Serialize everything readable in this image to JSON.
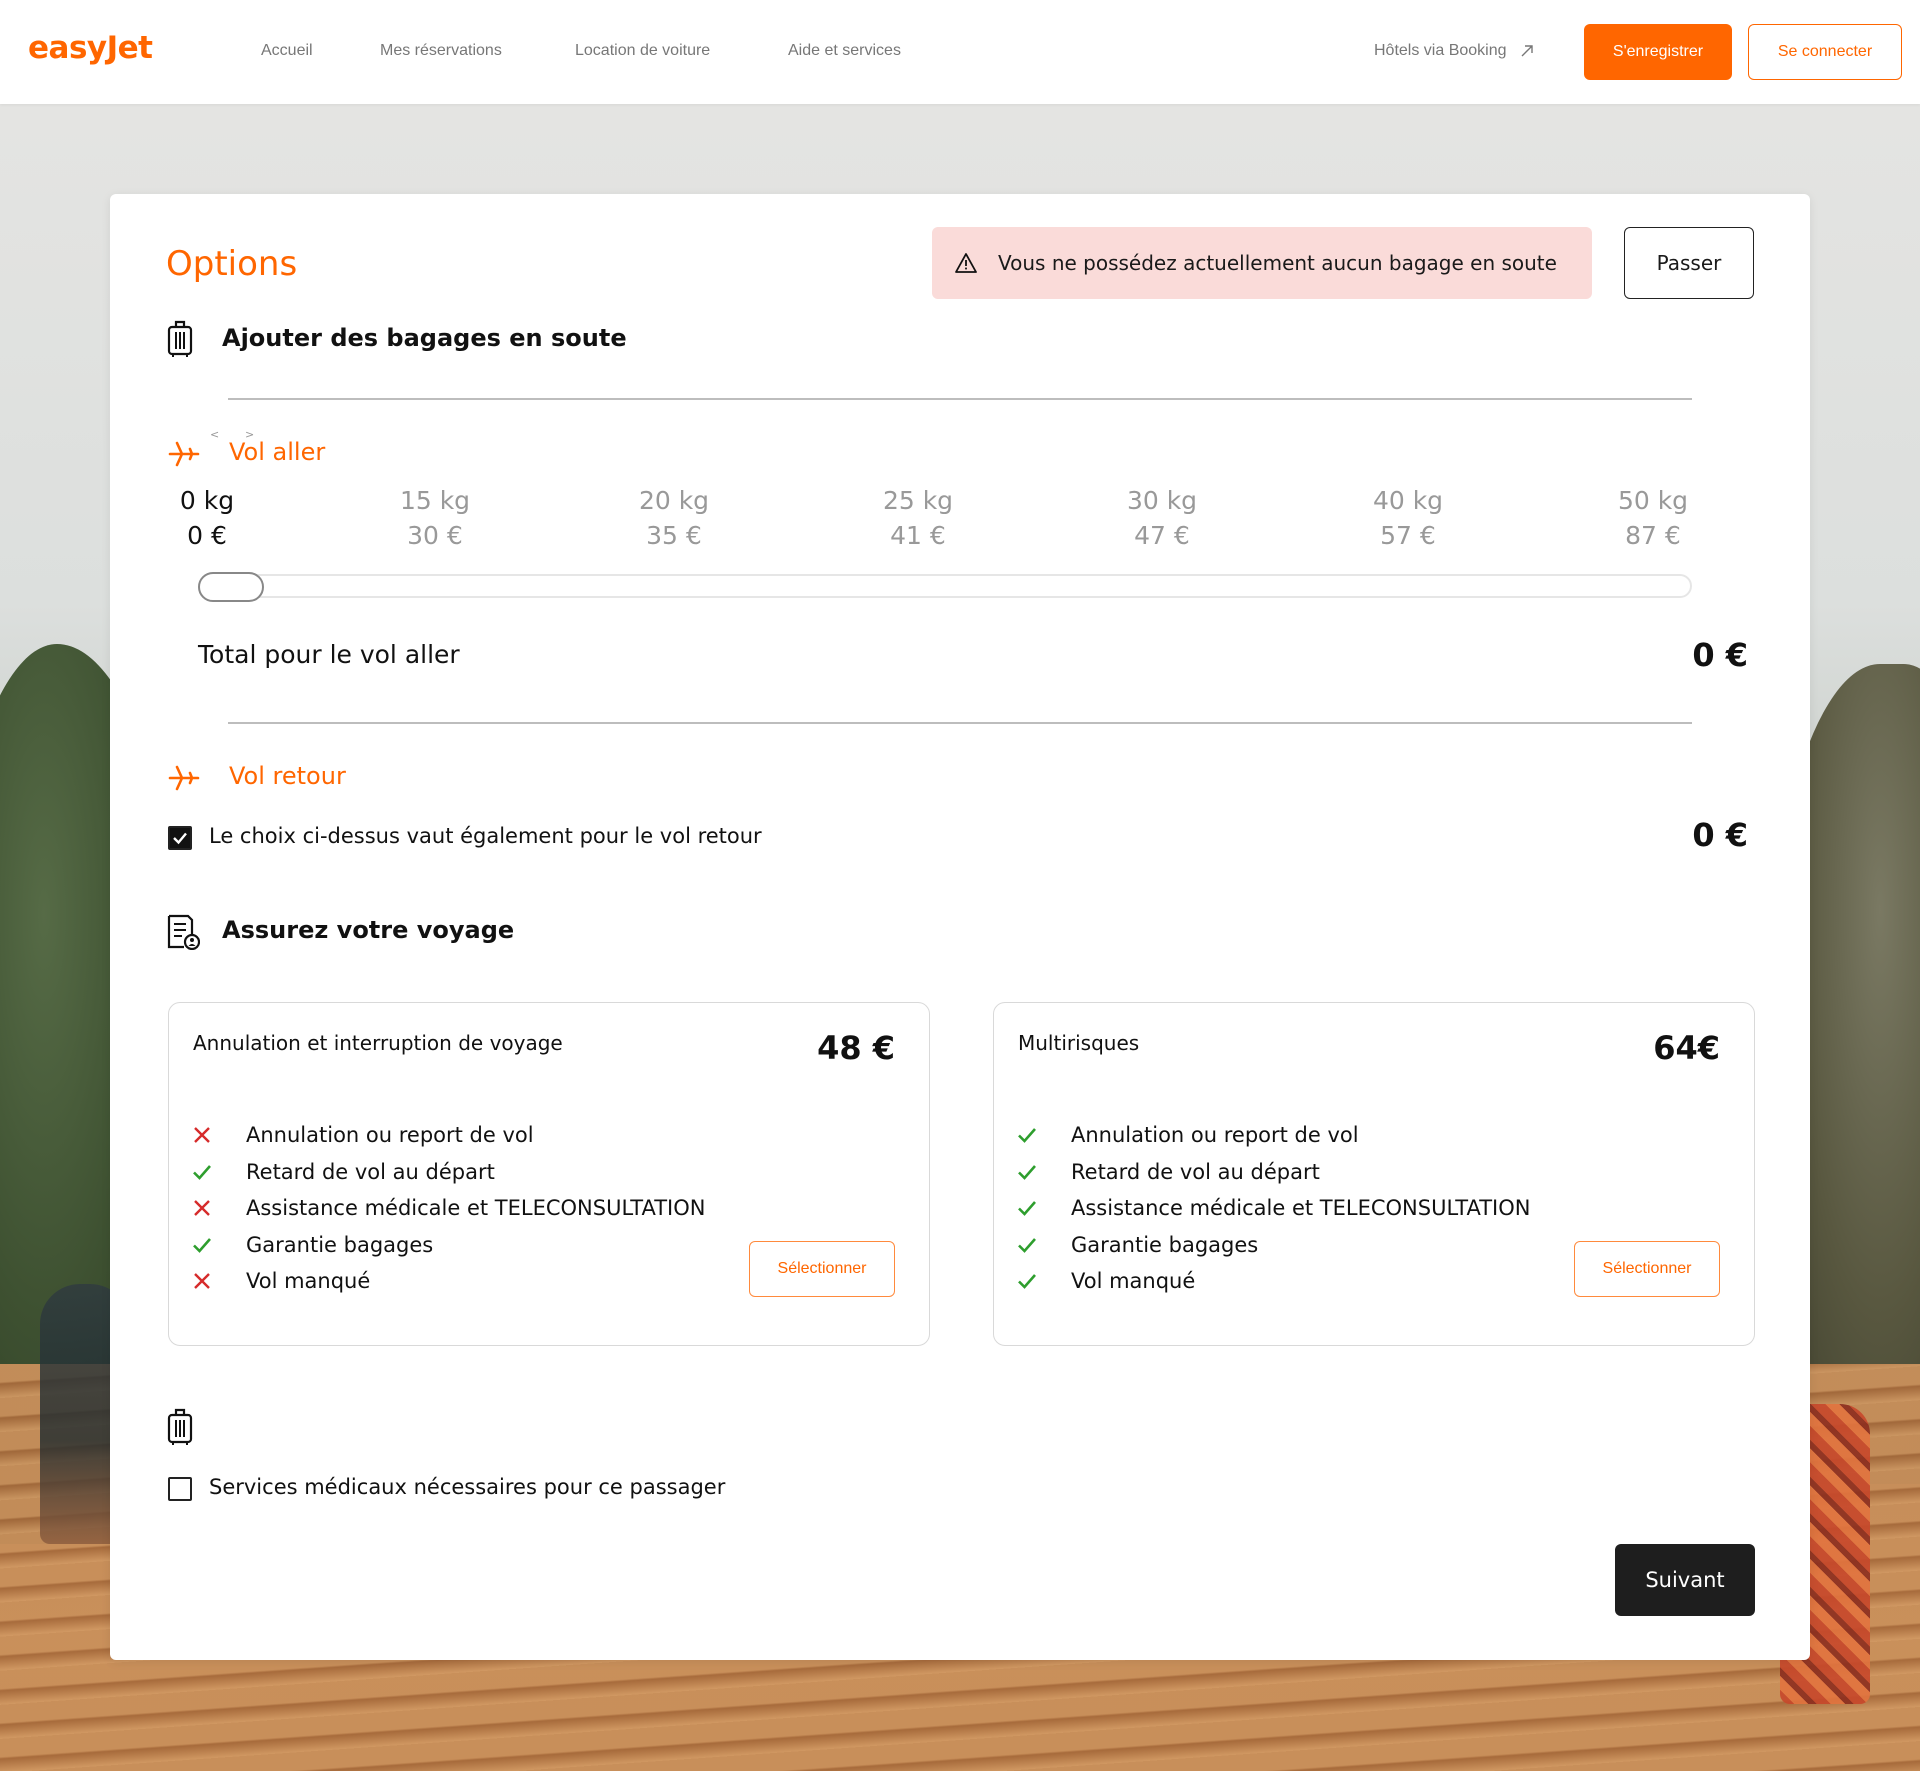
{
  "header": {
    "logo": "easyJet",
    "nav": [
      "Accueil",
      "Mes réservations",
      "Location de voiture",
      "Aide et services"
    ],
    "hotels": "Hôtels via Booking",
    "register": "S'enregistrer",
    "login": "Se connecter"
  },
  "options": {
    "title": "Options",
    "alert": "Vous ne possédez actuellement aucun bagage en soute",
    "skip": "Passer"
  },
  "baggage": {
    "title": "Ajouter des bagages en soute",
    "outbound": {
      "label": "Vol aller",
      "prev_arrow": "<",
      "next_arrow": ">",
      "selected_index": 0,
      "options": [
        {
          "kg": "0 kg",
          "price": "0 €"
        },
        {
          "kg": "15 kg",
          "price": "30 €"
        },
        {
          "kg": "20 kg",
          "price": "35 €"
        },
        {
          "kg": "25 kg",
          "price": "41 €"
        },
        {
          "kg": "30 kg",
          "price": "47 €"
        },
        {
          "kg": "40 kg",
          "price": "57 €"
        },
        {
          "kg": "50 kg",
          "price": "87 €"
        }
      ],
      "total_label": "Total pour le vol aller",
      "total_value": "0 €"
    },
    "return": {
      "label": "Vol retour",
      "same_choice_label": "Le choix ci-dessus vaut également pour le vol retour",
      "same_choice_checked": true,
      "total_value": "0 €"
    }
  },
  "insurance": {
    "title": "Assurez votre voyage",
    "plans": [
      {
        "name": "Annulation et interruption de voyage",
        "price": "48 €",
        "select_label": "Sélectionner",
        "features": [
          {
            "label": "Annulation ou report de vol",
            "included": false
          },
          {
            "label": "Retard de vol au départ",
            "included": true
          },
          {
            "label": "Assistance médicale et TELECONSULTATION",
            "included": false
          },
          {
            "label": "Garantie bagages",
            "included": true
          },
          {
            "label": "Vol manqué",
            "included": false
          }
        ]
      },
      {
        "name": "Multirisques",
        "price": "64€",
        "select_label": "Sélectionner",
        "features": [
          {
            "label": "Annulation ou report de vol",
            "included": true
          },
          {
            "label": "Retard de vol au départ",
            "included": true
          },
          {
            "label": "Assistance médicale et TELECONSULTATION",
            "included": true
          },
          {
            "label": "Garantie bagages",
            "included": true
          },
          {
            "label": "Vol manqué",
            "included": true
          }
        ]
      }
    ]
  },
  "medical": {
    "label": "Services médicaux nécessaires pour ce passager",
    "checked": false
  },
  "next_button": "Suivant",
  "colors": {
    "brand": "#ff6600",
    "alert_bg": "#fadbd9",
    "check_green": "#2e9e2e",
    "cross_red": "#d62b2b"
  }
}
